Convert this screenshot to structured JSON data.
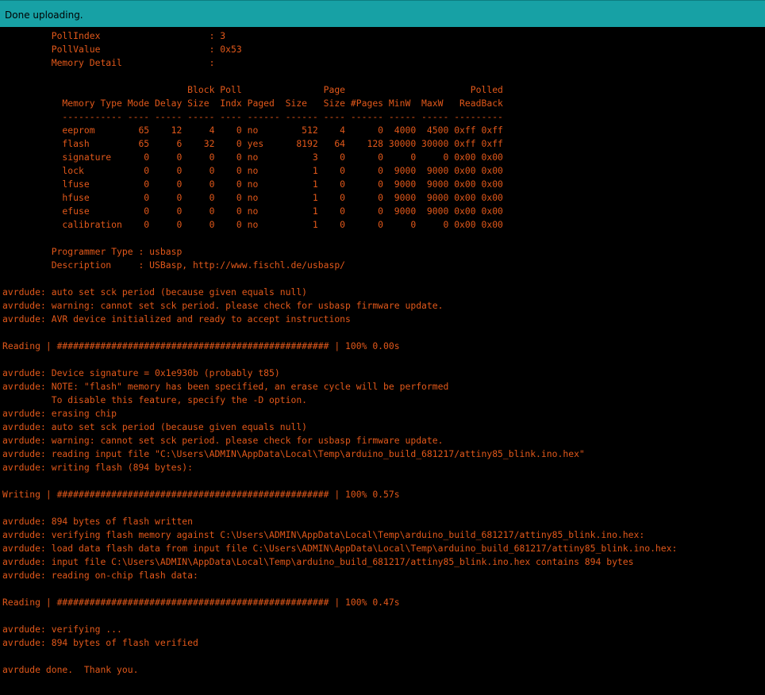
{
  "status_bar": {
    "message": "Done uploading.",
    "background": "#17a1a5"
  },
  "console": {
    "text_color": "#e2581a",
    "background": "#000000",
    "lines": [
      "         PollIndex                    : 3",
      "         PollValue                    : 0x53",
      "         Memory Detail                :",
      "",
      "                                  Block Poll               Page                       Polled",
      "           Memory Type Mode Delay Size  Indx Paged  Size   Size #Pages MinW  MaxW   ReadBack",
      "           ----------- ---- ----- ----- ---- ------ ------ ---- ------ ----- ----- ---------",
      "           eeprom        65    12     4    0 no        512    4      0  4000  4500 0xff 0xff",
      "           flash         65     6    32    0 yes      8192   64    128 30000 30000 0xff 0xff",
      "           signature      0     0     0    0 no          3    0      0     0     0 0x00 0x00",
      "           lock           0     0     0    0 no          1    0      0  9000  9000 0x00 0x00",
      "           lfuse          0     0     0    0 no          1    0      0  9000  9000 0x00 0x00",
      "           hfuse          0     0     0    0 no          1    0      0  9000  9000 0x00 0x00",
      "           efuse          0     0     0    0 no          1    0      0  9000  9000 0x00 0x00",
      "           calibration    0     0     0    0 no          1    0      0     0     0 0x00 0x00",
      "",
      "         Programmer Type : usbasp",
      "         Description     : USBasp, http://www.fischl.de/usbasp/",
      "",
      "avrdude: auto set sck period (because given equals null)",
      "avrdude: warning: cannot set sck period. please check for usbasp firmware update.",
      "avrdude: AVR device initialized and ready to accept instructions",
      "",
      "Reading | ################################################## | 100% 0.00s",
      "",
      "avrdude: Device signature = 0x1e930b (probably t85)",
      "avrdude: NOTE: \"flash\" memory has been specified, an erase cycle will be performed",
      "         To disable this feature, specify the -D option.",
      "avrdude: erasing chip",
      "avrdude: auto set sck period (because given equals null)",
      "avrdude: warning: cannot set sck period. please check for usbasp firmware update.",
      "avrdude: reading input file \"C:\\Users\\ADMIN\\AppData\\Local\\Temp\\arduino_build_681217/attiny85_blink.ino.hex\"",
      "avrdude: writing flash (894 bytes):",
      "",
      "Writing | ################################################## | 100% 0.57s",
      "",
      "avrdude: 894 bytes of flash written",
      "avrdude: verifying flash memory against C:\\Users\\ADMIN\\AppData\\Local\\Temp\\arduino_build_681217/attiny85_blink.ino.hex:",
      "avrdude: load data flash data from input file C:\\Users\\ADMIN\\AppData\\Local\\Temp\\arduino_build_681217/attiny85_blink.ino.hex:",
      "avrdude: input file C:\\Users\\ADMIN\\AppData\\Local\\Temp\\arduino_build_681217/attiny85_blink.ino.hex contains 894 bytes",
      "avrdude: reading on-chip flash data:",
      "",
      "Reading | ################################################## | 100% 0.47s",
      "",
      "avrdude: verifying ...",
      "avrdude: 894 bytes of flash verified",
      "",
      "avrdude done.  Thank you."
    ]
  }
}
